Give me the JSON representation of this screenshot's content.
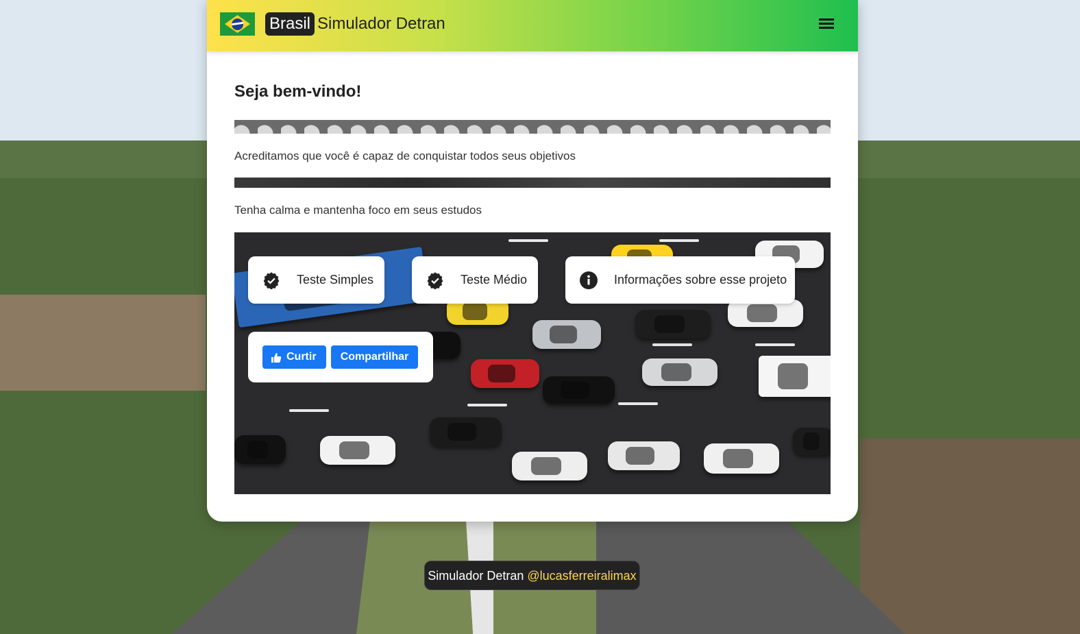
{
  "header": {
    "badge": "Brasil",
    "title": "Simulador Detran",
    "menu_icon": "hamburger-menu-icon",
    "flag_icon": "brazil-flag-icon"
  },
  "main": {
    "heading": "Seja bem-vindo!",
    "paragraph_1": "Acreditamos que você é capaz de conquistar todos seus objetivos",
    "paragraph_2": "Tenha calma e mantenha foco em seus estudos"
  },
  "cards": [
    {
      "label": "Teste Simples",
      "icon": "verified-badge-icon"
    },
    {
      "label": "Teste Médio",
      "icon": "verified-badge-icon"
    },
    {
      "label": "Informações sobre esse projeto",
      "icon": "info-icon"
    }
  ],
  "social": {
    "like_label": "Curtir",
    "like_icon": "thumbs-up-icon",
    "share_label": "Compartilhar"
  },
  "footer": {
    "text": "Simulador Detran",
    "handle": "@lucasferreiralimax"
  },
  "colors": {
    "header_gradient_start": "#ffe14a",
    "header_gradient_end": "#1fbf4f",
    "facebook_blue": "#1877f2",
    "footer_handle": "#ffd84a"
  }
}
